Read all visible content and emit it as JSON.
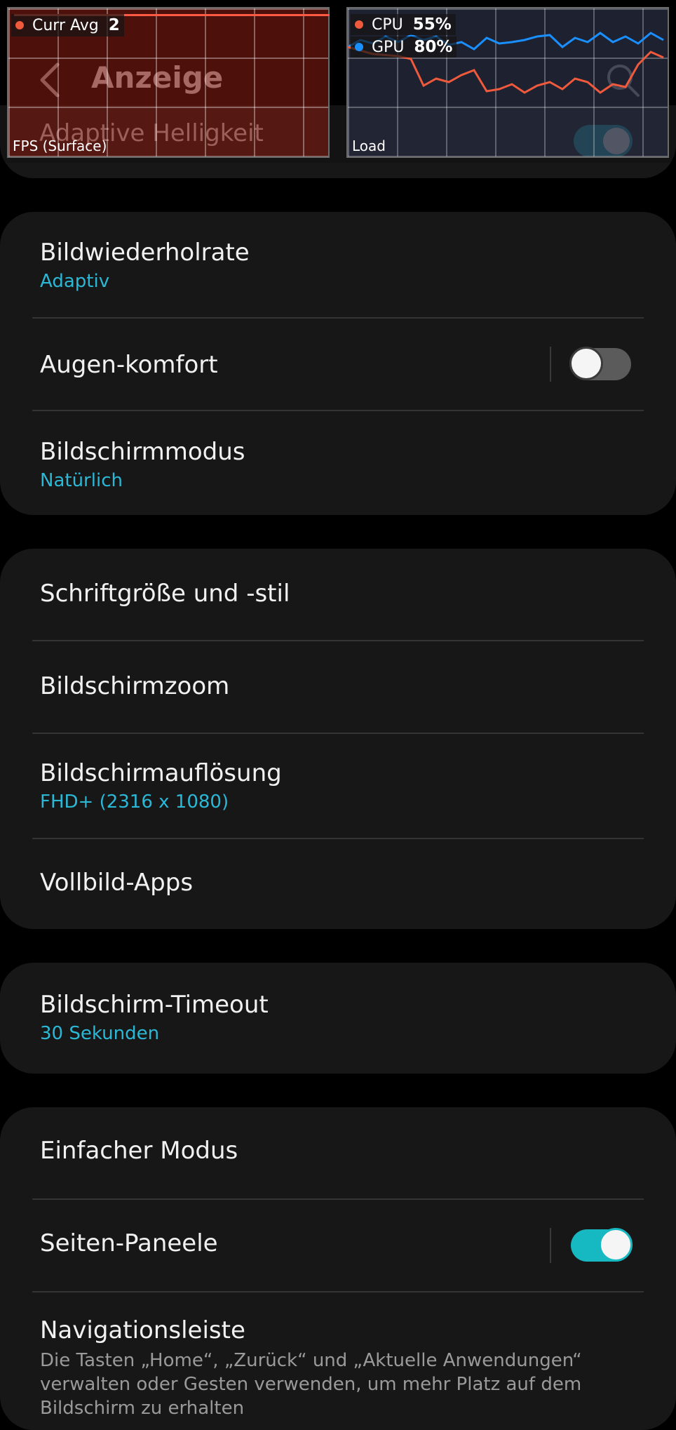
{
  "header": {
    "title": "Anzeige",
    "previous_item_label": "Adaptive Helligkeit"
  },
  "overlay": {
    "fps": {
      "legend_label": "Curr Avg",
      "value": "2",
      "panel_label": "FPS (Surface)"
    },
    "load": {
      "cpu_label": "CPU",
      "cpu_value": "55%",
      "gpu_label": "GPU",
      "gpu_value": "80%",
      "panel_label": "Load",
      "cpu_color": "#f05a3c",
      "gpu_color": "#1a8fff"
    }
  },
  "sections": [
    {
      "rows": [
        {
          "title": "Bildwiederholrate",
          "subtitle": "Adaptiv"
        },
        {
          "title": "Augen-komfort",
          "toggle": false
        },
        {
          "title": "Bildschirmmodus",
          "subtitle": "Natürlich"
        }
      ]
    },
    {
      "rows": [
        {
          "title": "Schriftgröße und -stil"
        },
        {
          "title": "Bildschirmzoom"
        },
        {
          "title": "Bildschirmauflösung",
          "subtitle": "FHD+ (2316 x 1080)"
        },
        {
          "title": "Vollbild-Apps"
        }
      ]
    },
    {
      "rows": [
        {
          "title": "Bildschirm-Timeout",
          "subtitle": "30 Sekunden"
        }
      ]
    },
    {
      "rows": [
        {
          "title": "Einfacher Modus"
        },
        {
          "title": "Seiten-Paneele",
          "toggle": true
        },
        {
          "title": "Navigationsleiste",
          "description": "Die Tasten „Home“, „Zurück“ und „Aktuelle Anwendungen“ verwalten oder Gesten verwenden, um mehr Platz auf dem Bildschirm zu erhalten"
        }
      ]
    }
  ],
  "colors": {
    "accent": "#2bb8d6",
    "toggle_on": "#16b8c1",
    "background": "#000000",
    "card": "#171717"
  }
}
